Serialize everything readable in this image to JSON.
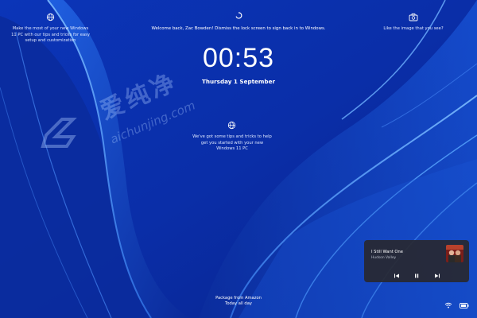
{
  "lock_screen": {
    "welcome_message": "Welcome back, Zac Bowden! Dismiss the lock screen to sign back in to Windows.",
    "time": "00:53",
    "date": "Thursday 1 September"
  },
  "widgets": {
    "top_left_tip": [
      "Make the most of your new Windows",
      "11 PC with our tips and tricks for easy",
      "setup and customization"
    ],
    "top_right": "Like the image that you see?",
    "center_tip": [
      "We've got some tips and tricks to help",
      "get you started with your new",
      "Windows 11 PC"
    ]
  },
  "watermark": {
    "chinese": "爱纯净",
    "url": "aichunjing.com"
  },
  "media_player": {
    "title": "I Still Want One",
    "artist": "Hudson Valley",
    "controls": [
      "previous",
      "pause",
      "next"
    ]
  },
  "footer_notification": [
    "Package from Amazon",
    "Today all day"
  ],
  "status_icons": [
    "wifi-icon",
    "battery-icon"
  ],
  "colors": {
    "background_base": "#0a2fae",
    "ribbon_light": "#5aa8ff",
    "media_bg": "#28282f"
  }
}
